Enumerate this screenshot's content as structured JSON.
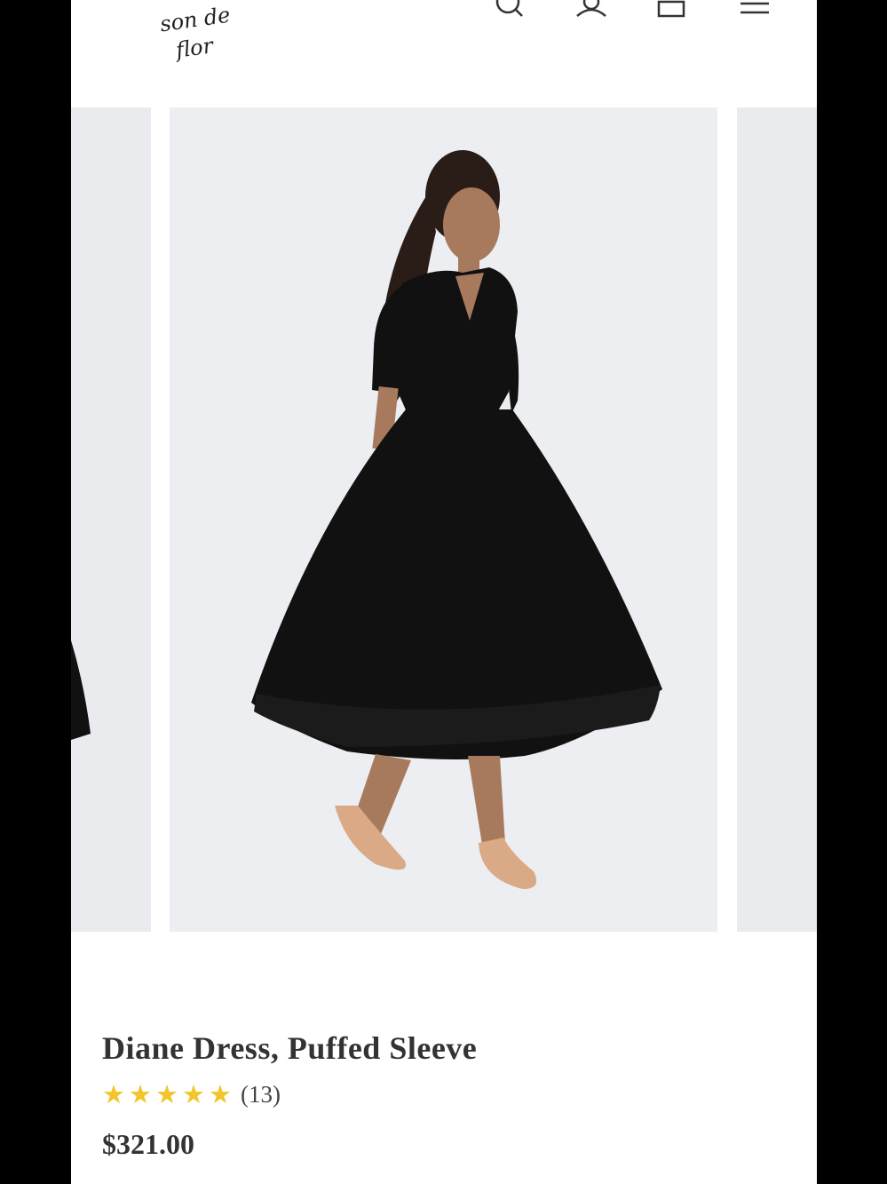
{
  "header": {
    "logo_line1": "son de",
    "logo_line2": "flor",
    "icons": [
      "search-icon",
      "account-icon",
      "cart-icon",
      "menu-icon"
    ]
  },
  "product": {
    "title": "Diane Dress, Puffed Sleeve",
    "rating": 5,
    "review_count": "(13)",
    "price": "$321.00"
  },
  "colors": {
    "star": "#f2c52b",
    "dress": "#111111",
    "background": "#eceef1"
  }
}
